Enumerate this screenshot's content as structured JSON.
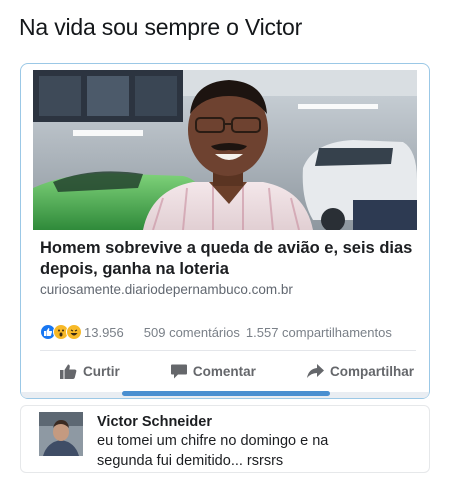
{
  "caption": "Na vida sou sempre o Victor",
  "post": {
    "headline_line1": "Homem sobrevive a queda de avião e, seis dias",
    "headline_line2": "depois, ganha na loteria",
    "domain": "curiosamente.diariodepernambuco.com.br",
    "reactions": {
      "icons": [
        "like-icon",
        "wow-icon",
        "haha-icon"
      ],
      "count": "13.956",
      "comments": "509 comentários",
      "shares": "1.557 compartilhamentos"
    },
    "actions": {
      "like": "Curtir",
      "comment": "Comentar",
      "share": "Compartilhar"
    }
  },
  "comment": {
    "author": "Victor Schneider",
    "line1": "eu tomei um chifre no domingo e na",
    "line2": "segunda fui demitido... rsrsrs"
  },
  "colors": {
    "like_blue": "#1877f2",
    "reaction_yellow": "#f7b928",
    "muted_text": "#65676b",
    "frame_border": "#9bc8e6"
  }
}
